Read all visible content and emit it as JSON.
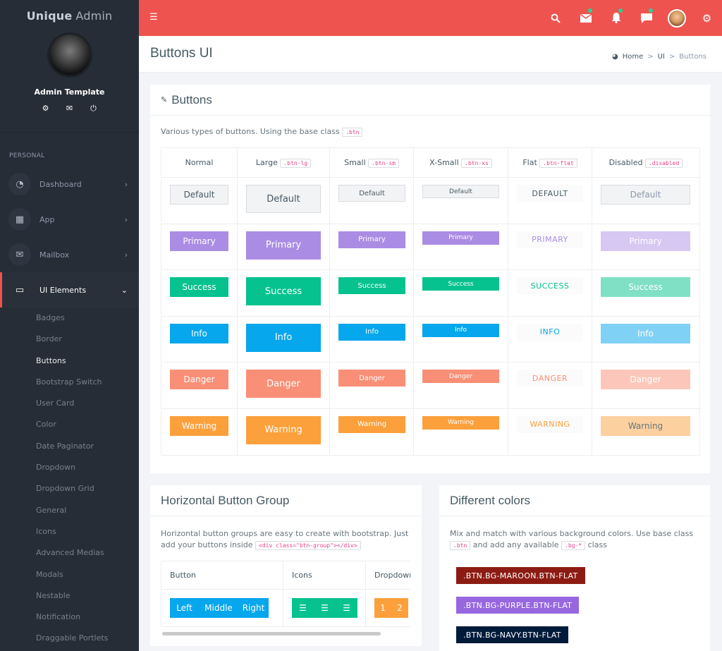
{
  "brand": {
    "bold": "Unique",
    "light": "Admin"
  },
  "user": {
    "name": "Admin Template"
  },
  "sidebar": {
    "section": "PERSONAL",
    "items": [
      {
        "label": "Dashboard",
        "icon": "dashboard-icon"
      },
      {
        "label": "App",
        "icon": "grid-icon"
      },
      {
        "label": "Mailbox",
        "icon": "envelope-icon"
      },
      {
        "label": "UI Elements",
        "icon": "laptop-icon"
      }
    ],
    "subitems": [
      "Badges",
      "Border",
      "Buttons",
      "Bootstrap Switch",
      "User Card",
      "Color",
      "Date Paginator",
      "Dropdown",
      "Dropdown Grid",
      "General",
      "Icons",
      "Advanced Medias",
      "Modals",
      "Nestable",
      "Notification",
      "Draggable Portlets"
    ]
  },
  "page": {
    "title": "Buttons UI",
    "breadcrumb": {
      "home": "Home",
      "sep1": ">",
      "ui": "UI",
      "sep2": ">",
      "current": "Buttons"
    }
  },
  "buttons_card": {
    "title": "Buttons",
    "desc": "Various types of buttons. Using the base class",
    "base_class": ".btn",
    "headers": {
      "normal": "Normal",
      "large": "Large",
      "large_code": ".btn-lg",
      "small": "Small",
      "small_code": ".btn-sm",
      "xsmall": "X-Small",
      "xsmall_code": ".btn-xs",
      "flat": "Flat",
      "flat_code": ".btn-flat",
      "disabled": "Disabled",
      "disabled_code": ".disabled"
    },
    "rows": [
      {
        "label": "Default",
        "flat": "DEFAULT"
      },
      {
        "label": "Primary",
        "flat": "PRIMARY"
      },
      {
        "label": "Success",
        "flat": "SUCCESS"
      },
      {
        "label": "Info",
        "flat": "INFO"
      },
      {
        "label": "Danger",
        "flat": "DANGER"
      },
      {
        "label": "Warning",
        "flat": "WARNING"
      }
    ]
  },
  "group_card": {
    "title": "Horizontal Button Group",
    "desc": "Horizontal button groups are easy to create with bootstrap. Just add your buttons inside",
    "code": "<div class=\"btn-group\"></div>",
    "headers": [
      "Button",
      "Icons",
      "Dropdown"
    ],
    "buttons": [
      "Left",
      "Middle",
      "Right"
    ],
    "dropdown": [
      "1",
      "2"
    ]
  },
  "colors_card": {
    "title": "Different colors",
    "desc1": "Mix and match with various background colors. Use base class",
    "code1": ".btn",
    "desc2": "and add any available",
    "code2": ".bg-*",
    "desc3": "class",
    "buttons": [
      {
        "label": ".BTN.BG-MAROON.BTN-FLAT",
        "color": "#8c1c13"
      },
      {
        "label": ".BTN.BG-PURPLE.BTN-FLAT",
        "color": "#9767e0"
      },
      {
        "label": ".BTN.BG-NAVY.BTN-FLAT",
        "color": "#001b3a"
      }
    ]
  },
  "colors": {
    "accent": "#ef5350",
    "sidebar": "#272d36",
    "primary": "#ab8ce4",
    "success": "#06c28f",
    "info": "#06a7ec",
    "danger": "#f98f76",
    "warning": "#fca03c"
  }
}
